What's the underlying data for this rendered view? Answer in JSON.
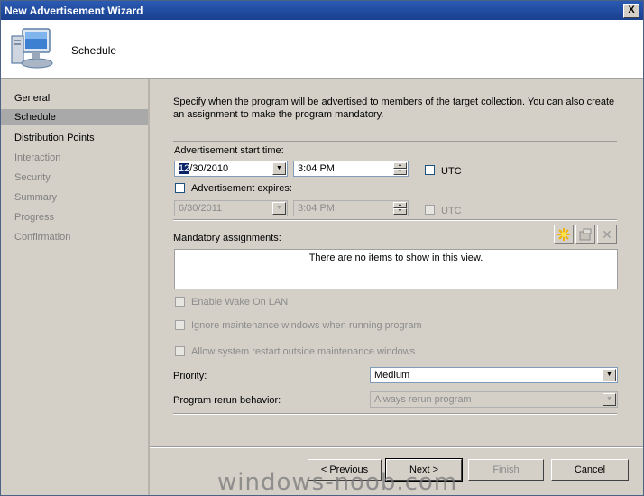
{
  "window": {
    "title": "New Advertisement Wizard",
    "close_glyph": "X"
  },
  "header": {
    "title": "Schedule",
    "icon": "computer-icon"
  },
  "nav": {
    "items": [
      {
        "label": "General",
        "state": "normal"
      },
      {
        "label": "Schedule",
        "state": "selected"
      },
      {
        "label": "Distribution Points",
        "state": "normal"
      },
      {
        "label": "Interaction",
        "state": "disabled"
      },
      {
        "label": "Security",
        "state": "disabled"
      },
      {
        "label": "Summary",
        "state": "disabled"
      },
      {
        "label": "Progress",
        "state": "disabled"
      },
      {
        "label": "Confirmation",
        "state": "disabled"
      }
    ]
  },
  "main": {
    "description": "Specify when the program will be advertised to members of the target collection. You can also create an assignment to make the program mandatory.",
    "start_time": {
      "label": "Advertisement start time:",
      "date_highlight": "12",
      "date_rest": "/30/2010",
      "time": "3:04 PM",
      "utc_label": "UTC",
      "utc_checked": false
    },
    "expires": {
      "label": "Advertisement expires:",
      "checked": false,
      "date": "6/30/2011",
      "time": "3:04 PM",
      "utc_label": "UTC",
      "utc_checked": false
    },
    "mandatory": {
      "label": "Mandatory assignments:",
      "empty_text": "There are no items to show in this view.",
      "toolbar": [
        "new-icon",
        "properties-icon",
        "delete-icon"
      ]
    },
    "options": [
      {
        "label": "Enable Wake On LAN",
        "checked": false,
        "disabled": true
      },
      {
        "label": "Ignore maintenance windows when running program",
        "checked": false,
        "disabled": true
      },
      {
        "label": "Allow system restart outside maintenance windows",
        "checked": false,
        "disabled": true
      }
    ],
    "priority": {
      "label": "Priority:",
      "value": "Medium"
    },
    "rerun": {
      "label": "Program rerun behavior:",
      "value": "Always rerun program"
    }
  },
  "buttons": {
    "previous": "< Previous",
    "next": "Next >",
    "finish": "Finish",
    "cancel": "Cancel"
  },
  "watermark": "windows-noob.com",
  "colors": {
    "titlebar": "#2a5bb2",
    "selection": "#0a246a",
    "nav_selected": "#a9a9a9"
  }
}
